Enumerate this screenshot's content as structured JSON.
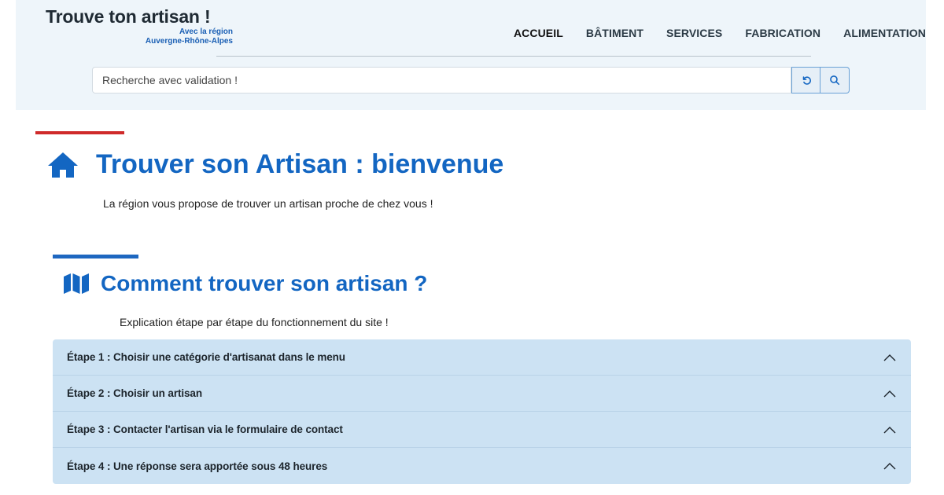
{
  "brand": {
    "title": "Trouve ton artisan !",
    "sub_line1": "Avec la région",
    "sub_line2": "Auvergne-Rhône-Alpes"
  },
  "nav": {
    "items": [
      {
        "label": "ACCUEIL",
        "active": true
      },
      {
        "label": "BÂTIMENT",
        "active": false
      },
      {
        "label": "SERVICES",
        "active": false
      },
      {
        "label": "FABRICATION",
        "active": false
      },
      {
        "label": "ALIMENTATION",
        "active": false
      }
    ]
  },
  "search": {
    "placeholder": "Recherche avec validation !",
    "value": "",
    "reset_icon": "reset-icon",
    "submit_icon": "search-icon"
  },
  "welcome": {
    "icon": "home-icon",
    "title": "Trouver son Artisan : bienvenue",
    "intro": "La région vous propose de trouver un artisan proche de chez vous !"
  },
  "howto": {
    "icon": "map-icon",
    "title": "Comment trouver son artisan ?",
    "explain": "Explication étape par étape du fonctionnement du site !",
    "steps": [
      {
        "label": "Étape 1 : Choisir une catégorie d'artisanat dans le menu"
      },
      {
        "label": "Étape 2 : Choisir un artisan"
      },
      {
        "label": "Étape 3 : Contacter l'artisan via le formulaire de contact"
      },
      {
        "label": "Étape 4 : Une réponse sera apportée sous 48 heures"
      }
    ]
  },
  "colors": {
    "header_bg": "#eef5fa",
    "accent_blue": "#1366c2",
    "accent_red": "#cf2a2a",
    "accordion_bg": "#cce2f3"
  }
}
